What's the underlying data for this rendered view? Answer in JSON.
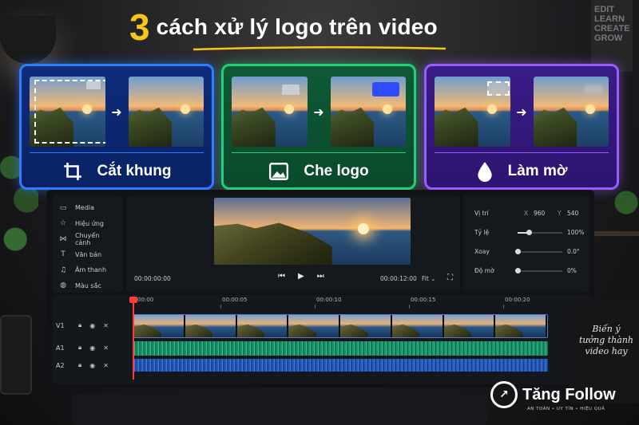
{
  "title": {
    "number": "3",
    "text": "cách xử lý logo trên video"
  },
  "background": {
    "poster_words": [
      "EDIT",
      "LEARN",
      "CREATE",
      "GROW"
    ]
  },
  "cards": [
    {
      "id": "crop",
      "label": "Cắt khung",
      "icon": "crop-icon",
      "accent": "#2f7cff"
    },
    {
      "id": "cover",
      "label": "Che logo",
      "icon": "image-icon",
      "accent": "#22d07a"
    },
    {
      "id": "blur",
      "label": "Làm mờ",
      "icon": "droplet-icon",
      "accent": "#9a5cff"
    }
  ],
  "editor": {
    "sidebar": [
      {
        "label": "Media",
        "icon": "folder-icon"
      },
      {
        "label": "Hiệu ứng",
        "icon": "star-icon"
      },
      {
        "label": "Chuyển cảnh",
        "icon": "transition-icon"
      },
      {
        "label": "Văn bản",
        "icon": "text-icon"
      },
      {
        "label": "Âm thanh",
        "icon": "music-icon"
      },
      {
        "label": "Màu sắc",
        "icon": "color-icon"
      }
    ],
    "preview": {
      "timecode_current": "00:00:00:00",
      "timecode_total": "00:00:12:00",
      "fit": "Fit"
    },
    "properties": {
      "position": {
        "label": "Vị trí",
        "x_label": "X",
        "x": "960",
        "y_label": "Y",
        "y": "540"
      },
      "scale": {
        "label": "Tỷ lệ",
        "value": "100%",
        "level": 0.25
      },
      "rotate": {
        "label": "Xoay",
        "value": "0.0°",
        "level": 0.0
      },
      "opacity": {
        "label": "Độ mờ",
        "value": "0%",
        "level": 0.0
      }
    },
    "timeline": {
      "ruler": [
        "00:00",
        "00:00:05",
        "00:00:10",
        "00:00:15",
        "00:00:20"
      ],
      "tracks": [
        "V1",
        "A1",
        "A2"
      ]
    }
  },
  "mug_text": "Biến ý tưởng thành video hay",
  "brand": {
    "name": "Tăng Follow",
    "tagline": "AN TOÀN • UY TÍN • HIỆU QUẢ"
  },
  "colors": {
    "title_number": "#f5c518",
    "crop": "#2f7cff",
    "cover": "#22d07a",
    "blur": "#9a5cff",
    "playhead": "#ff3a3a"
  }
}
